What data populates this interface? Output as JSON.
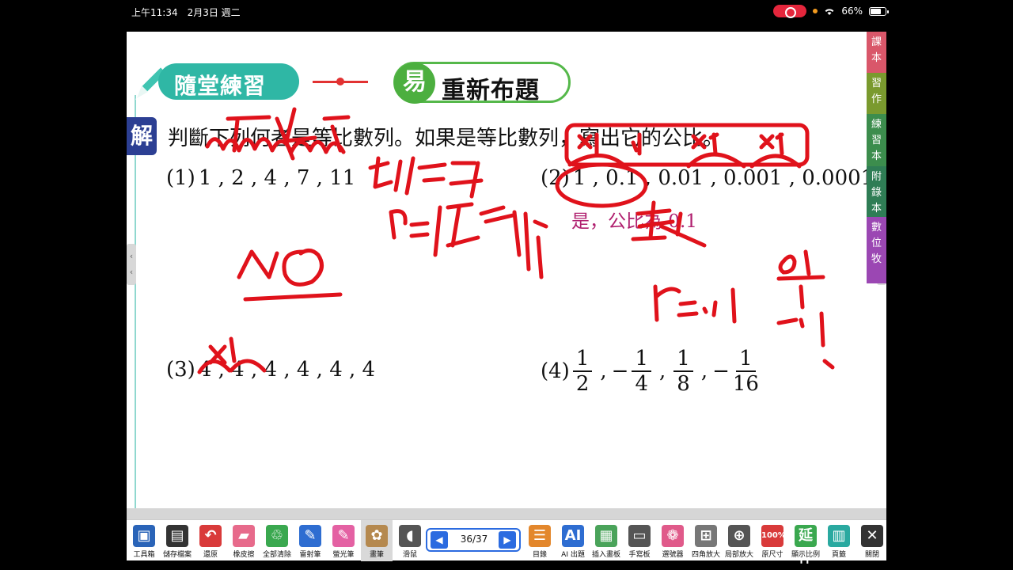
{
  "status_bar": {
    "time": "上午11:34　2月3日 週二",
    "battery": "66%"
  },
  "header": {
    "section_label": "隨堂練習",
    "difficulty_badge": "易",
    "title": "重新布題"
  },
  "question": {
    "badge": "解",
    "text": "判斷下列何者是等比數列。如果是等比數列，寫出它的公比。"
  },
  "problems": {
    "p1": {
      "num": "(1)",
      "seq": "1 , 2 , 4 , 7 , 11"
    },
    "p2": {
      "num": "(2)",
      "seq": "1 , 0.1 , 0.01 , 0.001 , 0.0001",
      "answer": "是，公比為 0.1"
    },
    "p3": {
      "num": "(3)",
      "seq": "4 , 4 , 4 , 4 , 4 , 4"
    },
    "p4": {
      "num": "(4)",
      "terms": [
        {
          "sign": "",
          "n": "1",
          "d": "2"
        },
        {
          "sign": "−",
          "n": "1",
          "d": "4"
        },
        {
          "sign": "",
          "n": "1",
          "d": "8"
        },
        {
          "sign": "−",
          "n": "1",
          "d": "16"
        }
      ]
    }
  },
  "side_tabs": [
    {
      "label": "課本",
      "color": "#d9576a"
    },
    {
      "label": "習作",
      "color": "#7a9a2e"
    },
    {
      "label": "練習本",
      "color": "#3c8d4d"
    },
    {
      "label": "附錄本",
      "color": "#2f7d55"
    },
    {
      "label": "數位牧",
      "color": "#9b47b3"
    }
  ],
  "toolbar": {
    "tools": [
      {
        "label": "工具箱",
        "icon": "toolbox-icon",
        "color": "#2a64b8",
        "glyph": "▣"
      },
      {
        "label": "儲存檔案",
        "icon": "save-icon",
        "color": "#333333",
        "glyph": "▤"
      },
      {
        "label": "還原",
        "icon": "undo-icon",
        "color": "#d93a3a",
        "glyph": "↶"
      },
      {
        "label": "橡皮擦",
        "icon": "eraser-icon",
        "color": "#e76a8b",
        "glyph": "▰"
      },
      {
        "label": "全部清除",
        "icon": "clear-all-icon",
        "color": "#3aa84f",
        "glyph": "♲"
      },
      {
        "label": "雷射筆",
        "icon": "laser-pen-icon",
        "color": "#2e6dd1",
        "glyph": "✎"
      },
      {
        "label": "螢光筆",
        "icon": "highlighter-icon",
        "color": "#e461a3",
        "glyph": "✎"
      },
      {
        "label": "畫筆",
        "icon": "palette-icon",
        "color": "#b5894f",
        "glyph": "✿"
      },
      {
        "label": "滑鼠",
        "icon": "mouse-icon",
        "color": "#555555",
        "glyph": "◖"
      }
    ],
    "pager": {
      "current": "36/37"
    },
    "tools_right": [
      {
        "label": "目錄",
        "icon": "contents-icon",
        "color": "#e3872c",
        "glyph": "☰"
      },
      {
        "label": "AI 出題",
        "icon": "ai-question-icon",
        "color": "#2e6dd1",
        "glyph": "AI"
      },
      {
        "label": "插入畫板",
        "icon": "insert-board-icon",
        "color": "#4aa35a",
        "glyph": "▦"
      },
      {
        "label": "手寫板",
        "icon": "handwriting-board-icon",
        "color": "#555555",
        "glyph": "▭"
      },
      {
        "label": "選號器",
        "icon": "number-picker-icon",
        "color": "#e05a8a",
        "glyph": "❁"
      },
      {
        "label": "四角放大",
        "icon": "four-corner-zoom-icon",
        "color": "#777777",
        "glyph": "⊞"
      },
      {
        "label": "局部放大",
        "icon": "local-zoom-icon",
        "color": "#555555",
        "glyph": "⊕"
      },
      {
        "label": "原尺寸",
        "icon": "original-size-icon",
        "color": "#d93a3a",
        "glyph": "100%"
      },
      {
        "label": "顯示比例",
        "icon": "display-ratio-icon",
        "color": "#3aa84f",
        "glyph": "延伸"
      },
      {
        "label": "頁籤",
        "icon": "tab-icon",
        "color": "#2aa9a0",
        "glyph": "▥"
      },
      {
        "label": "關閉",
        "icon": "close-icon",
        "color": "#333333",
        "glyph": "✕"
      }
    ]
  }
}
